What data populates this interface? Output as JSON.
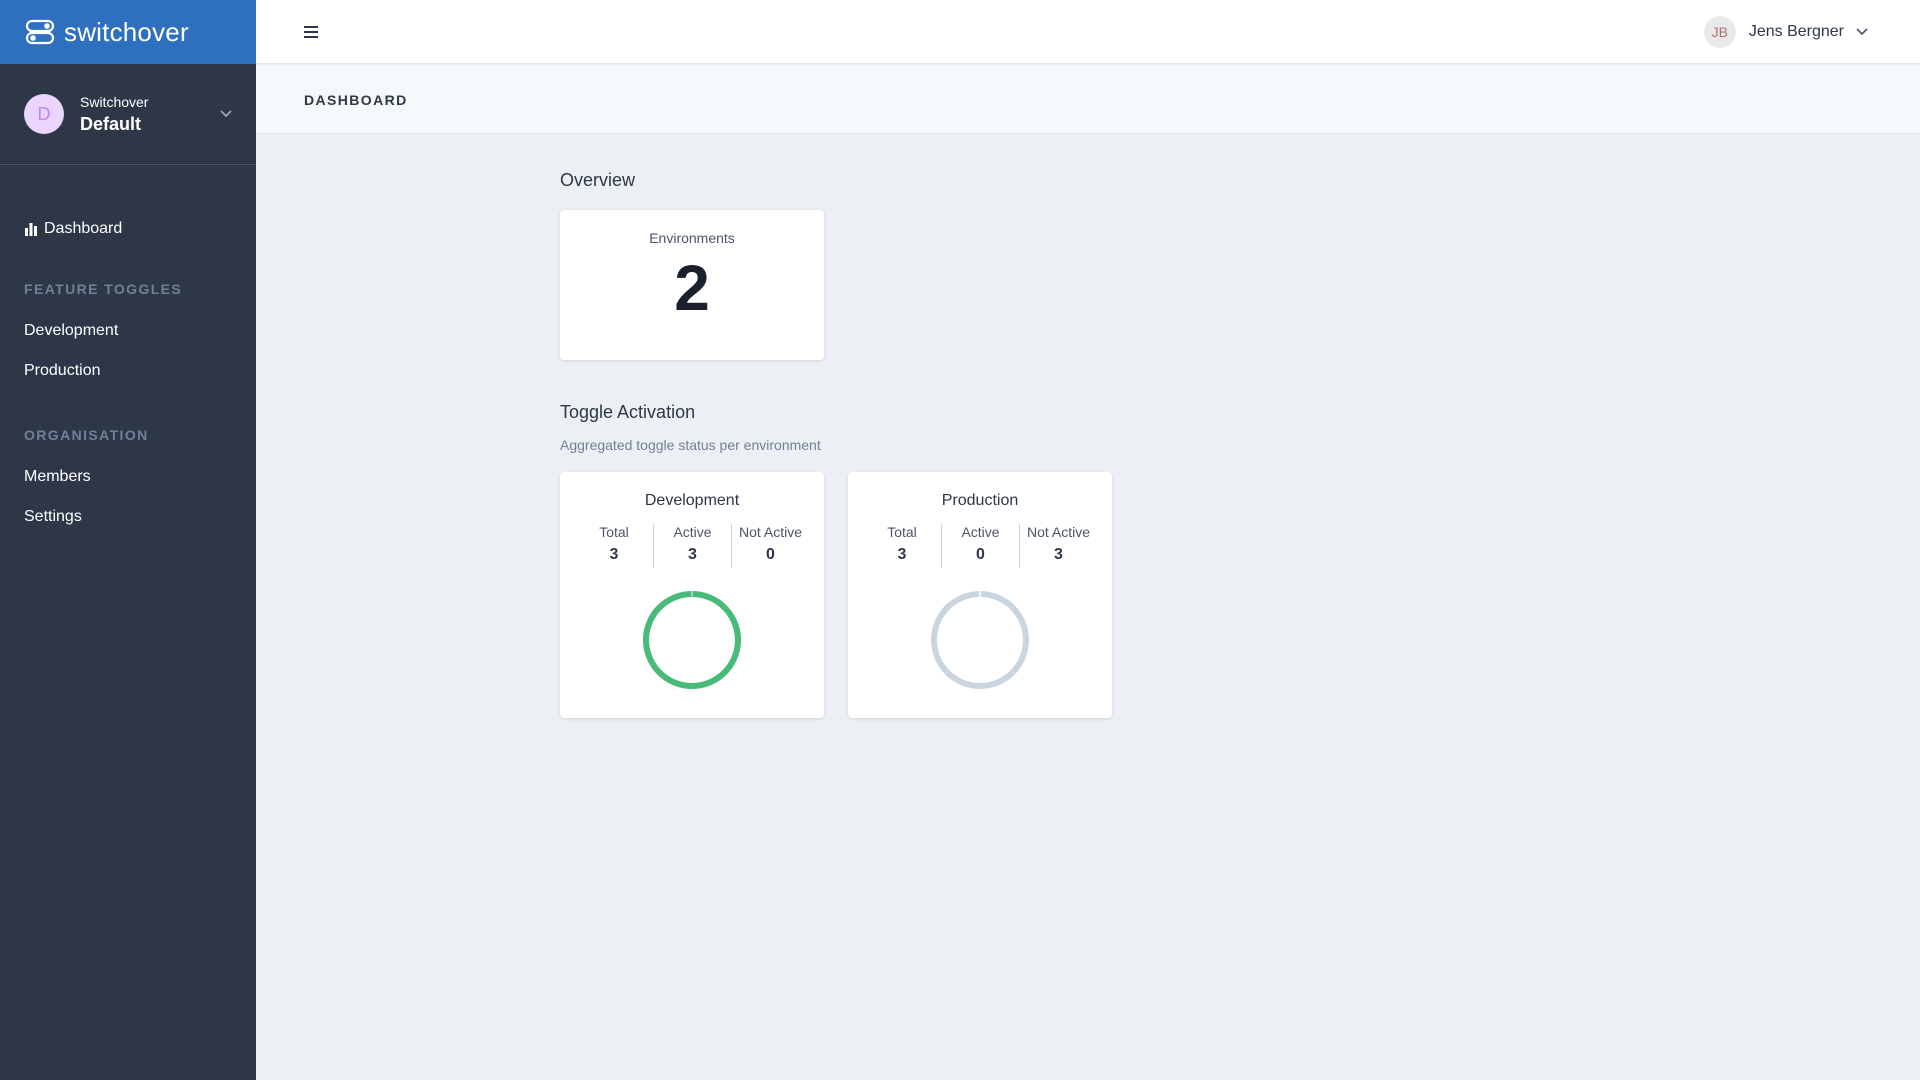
{
  "brand": {
    "name": "switchover",
    "logo_icon": "toggle-logo-icon"
  },
  "organization": {
    "initial": "D",
    "label": "Switchover",
    "name": "Default"
  },
  "nav": {
    "dashboard": "Dashboard",
    "feature_toggles_heading": "FEATURE TOGGLES",
    "feature_toggles": [
      "Development",
      "Production"
    ],
    "organisation_heading": "ORGANISATION",
    "organisation": [
      "Members",
      "Settings"
    ]
  },
  "user": {
    "initials": "JB",
    "name": "Jens Bergner"
  },
  "page": {
    "title": "DASHBOARD"
  },
  "overview": {
    "title": "Overview",
    "environments_label": "Environments",
    "environments_count": "2"
  },
  "toggle_activation": {
    "title": "Toggle Activation",
    "subtitle": "Aggregated toggle status per environment",
    "labels": {
      "total": "Total",
      "active": "Active",
      "not_active": "Not Active"
    },
    "environments": [
      {
        "name": "Development",
        "total": "3",
        "active": "3",
        "not_active": "0"
      },
      {
        "name": "Production",
        "total": "3",
        "active": "0",
        "not_active": "3"
      }
    ]
  },
  "colors": {
    "sidebar": "#2d3748",
    "brand_bar": "#2f6fc0",
    "active": "#48bb78",
    "inactive": "#cbd5e0"
  }
}
